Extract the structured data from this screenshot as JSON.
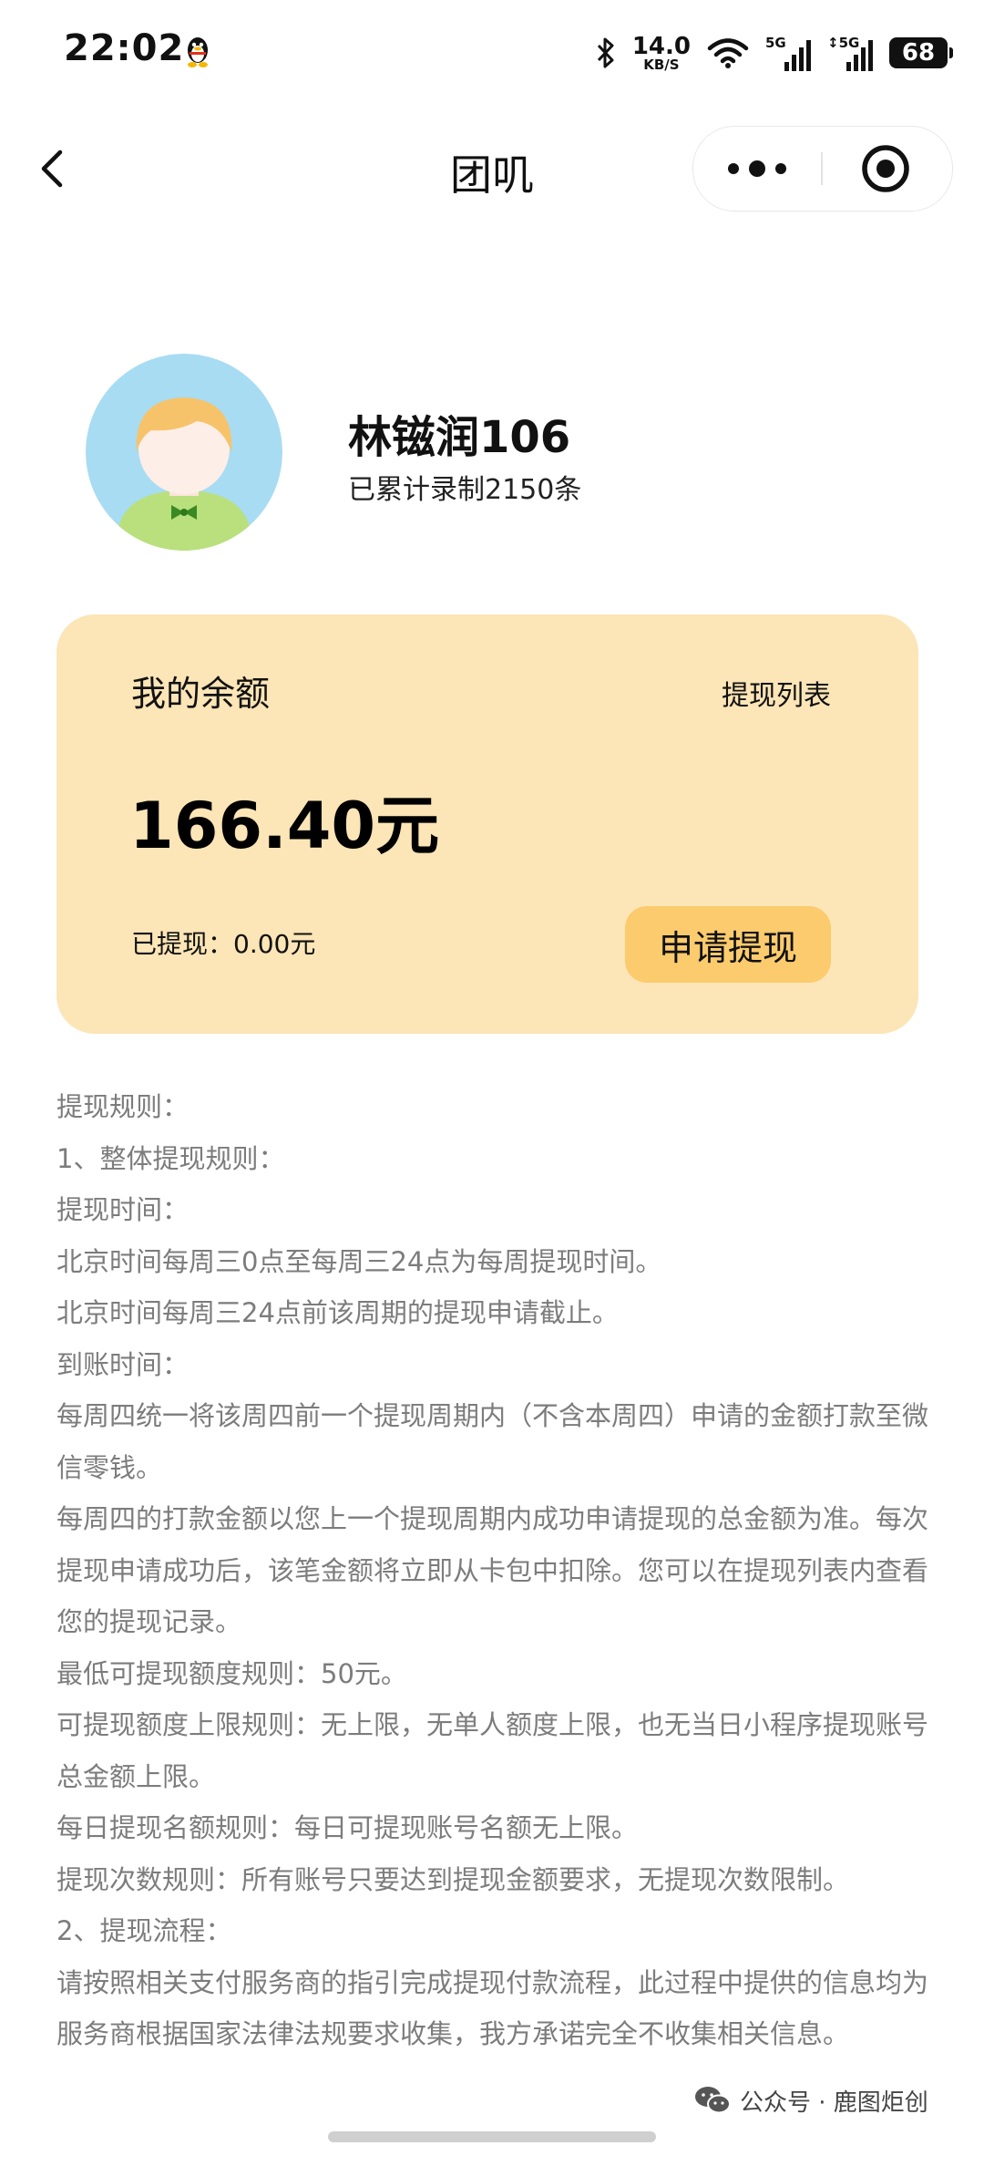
{
  "status_bar": {
    "time": "22:02",
    "net_speed": "14.0",
    "net_speed_unit": "KB/S",
    "sim1_tag": "5G",
    "sim2_tag": "↕5G",
    "battery": "68",
    "icons": [
      "qq-penguin-icon",
      "bluetooth-icon",
      "wifi-icon",
      "signal-icon",
      "battery-icon"
    ]
  },
  "nav": {
    "title": "团叽",
    "icons": [
      "back-arrow-icon",
      "more-dots-icon",
      "target-icon"
    ]
  },
  "profile": {
    "name": "林镃润106",
    "record_count": "已累计录制2150条"
  },
  "balance_card": {
    "label": "我的余额",
    "withdraw_list_link": "提现列表",
    "amount": "166.40元",
    "withdrawn": "已提现：0.00元",
    "apply_button": "申请提现",
    "colors": {
      "card_bg": "#fce5b6",
      "button_bg": "#fbcb6d"
    }
  },
  "rules": {
    "lines": [
      "提现规则：",
      "1、整体提现规则：",
      "提现时间：",
      "北京时间每周三0点至每周三24点为每周提现时间。",
      "北京时间每周三24点前该周期的提现申请截止。",
      "到账时间：",
      "每周四统一将该周四前一个提现周期内（不含本周四）申请的金额打款至微信零钱。",
      "每周四的打款金额以您上一个提现周期内成功申请提现的总金额为准。每次提现申请成功后，该笔金额将立即从卡包中扣除。您可以在提现列表内查看您的提现记录。",
      "最低可提现额度规则：50元。",
      "可提现额度上限规则：无上限，无单人额度上限，也无当日小程序提现账号总金额上限。",
      "每日提现名额规则：每日可提现账号名额无上限。",
      "提现次数规则：所有账号只要达到提现金额要求，无提现次数限制。",
      "2、提现流程：",
      "请按照相关支付服务商的指引完成提现付款流程，此过程中提供的信息均为服务商根据国家法律法规要求收集，我方承诺完全不收集相关信息。"
    ]
  },
  "watermark": {
    "text": "公众号 · 鹿图炬创",
    "icon": "wechat-icon"
  }
}
